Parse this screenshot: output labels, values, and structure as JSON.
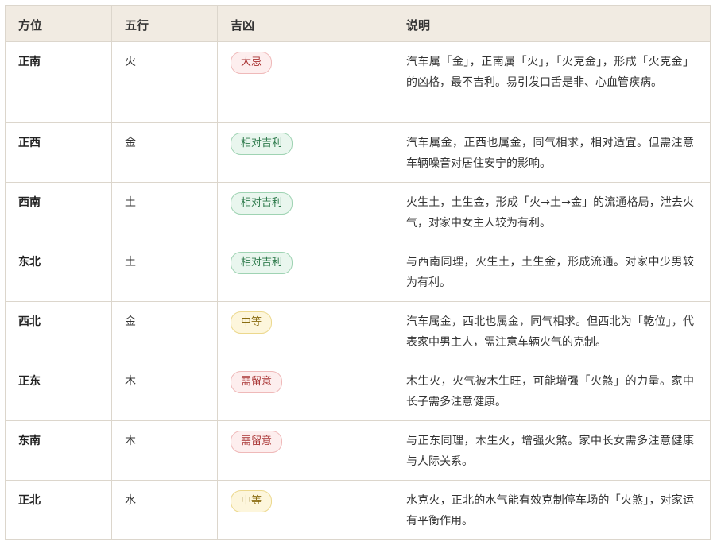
{
  "header": {
    "col_direction": "方位",
    "col_element": "五行",
    "col_fortune": "吉凶",
    "col_desc": "说明"
  },
  "colors": {
    "header_bg": "#f1ebe2",
    "border": "#dcd6cc",
    "badge_red": "#a83232",
    "badge_green": "#2d7a4b",
    "badge_yellow": "#8a6d12"
  },
  "rows": [
    {
      "direction": "正南",
      "element": "火",
      "fortune": "大忌",
      "level": "red",
      "desc": "汽车属「金」，正南属「火」，「火克金」，形成「火克金」的凶格，最不吉利。易引发口舌是非、心血管疾病。"
    },
    {
      "direction": "正西",
      "element": "金",
      "fortune": "相对吉利",
      "level": "green",
      "desc": "汽车属金，正西也属金，同气相求，相对适宜。但需注意车辆噪音对居住安宁的影响。"
    },
    {
      "direction": "西南",
      "element": "土",
      "fortune": "相对吉利",
      "level": "green",
      "desc": "火生土，土生金，形成「火→土→金」的流通格局，泄去火气，对家中女主人较为有利。"
    },
    {
      "direction": "东北",
      "element": "土",
      "fortune": "相对吉利",
      "level": "green",
      "desc": "与西南同理，火生土，土生金，形成流通。对家中少男较为有利。"
    },
    {
      "direction": "西北",
      "element": "金",
      "fortune": "中等",
      "level": "yellow",
      "desc": "汽车属金，西北也属金，同气相求。但西北为「乾位」，代表家中男主人，需注意车辆火气的克制。"
    },
    {
      "direction": "正东",
      "element": "木",
      "fortune": "需留意",
      "level": "red",
      "desc": "木生火，火气被木生旺，可能增强「火煞」的力量。家中长子需多注意健康。"
    },
    {
      "direction": "东南",
      "element": "木",
      "fortune": "需留意",
      "level": "red",
      "desc": "与正东同理，木生火，增强火煞。家中长女需多注意健康与人际关系。"
    },
    {
      "direction": "正北",
      "element": "水",
      "fortune": "中等",
      "level": "yellow",
      "desc": "水克火，正北的水气能有效克制停车场的「火煞」，对家运有平衡作用。"
    }
  ]
}
